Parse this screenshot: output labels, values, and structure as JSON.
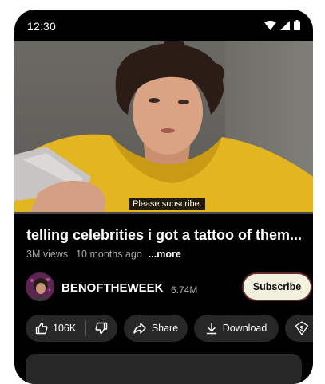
{
  "status_bar": {
    "time": "12:30"
  },
  "video": {
    "caption": "Please subscribe."
  },
  "details": {
    "title": "telling celebrities i got a tattoo of them...",
    "views": "3M views",
    "age": "10 months ago",
    "more_label": "...more"
  },
  "channel": {
    "name": "BENOFTHEWEEK",
    "subscribers": "6.74M",
    "subscribe_label": "Subscribe"
  },
  "actions": {
    "like_count": "106K",
    "share_label": "Share",
    "download_label": "Download"
  },
  "colors": {
    "background": "#000000",
    "pill": "#272727",
    "subscribe_bg": "#f1f1dd",
    "meta_text": "#aaaaaa"
  }
}
